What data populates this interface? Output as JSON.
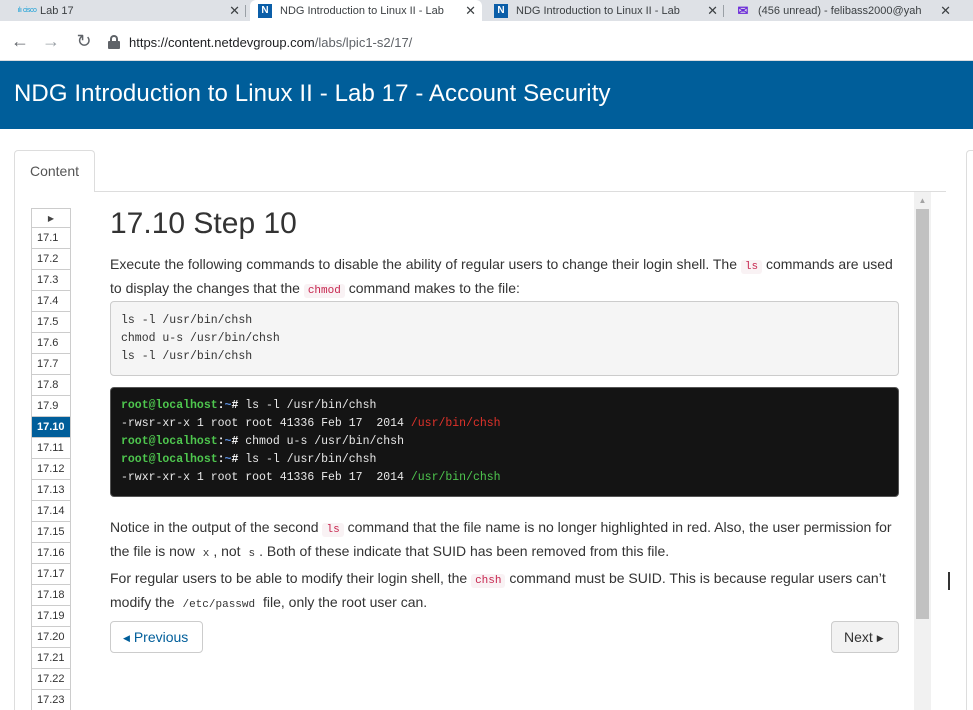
{
  "browser": {
    "tabs": [
      {
        "title": "Lab 17",
        "icon": "cisco-icon",
        "active": false
      },
      {
        "title": "NDG Introduction to Linux II - Lab",
        "icon": "ndg-n-icon",
        "active": true
      },
      {
        "title": "NDG Introduction to Linux II - Lab",
        "icon": "ndg-n-icon",
        "active": false
      },
      {
        "title": "(456 unread) - felibass2000@yah",
        "icon": "yahoo-mail-icon",
        "active": false
      }
    ],
    "url_host": "https://content.netdevgroup.com",
    "url_path": "/labs/lpic1-s2/17/",
    "fav_n": "N",
    "fav_cisco": "ılıılı cisco"
  },
  "header": {
    "title": "NDG Introduction to Linux II - Lab 17 - Account Security"
  },
  "content_tab": {
    "label": "Content"
  },
  "step_nav": {
    "items": [
      "17.1",
      "17.2",
      "17.3",
      "17.4",
      "17.5",
      "17.6",
      "17.7",
      "17.8",
      "17.9",
      "17.10",
      "17.11",
      "17.12",
      "17.13",
      "17.14",
      "17.15",
      "17.16",
      "17.17",
      "17.18",
      "17.19",
      "17.20",
      "17.21",
      "17.22",
      "17.23"
    ],
    "active": "17.10"
  },
  "main": {
    "heading": "17.10 Step 10",
    "intro": {
      "t1": "Execute the following commands to disable the ability of regular users to change their login shell. The ",
      "c1": "ls",
      "t2": " commands are used to display the changes that the ",
      "c2": "chmod",
      "t3": " command makes to the file:"
    },
    "commands": [
      "ls -l /usr/bin/chsh",
      "chmod u-s /usr/bin/chsh",
      "ls -l /usr/bin/chsh"
    ],
    "terminal": {
      "prompt_user": "root@localhost",
      "prompt_colon": ":",
      "prompt_tilde": "~",
      "prompt_hash": "#",
      "cmd1": " ls -l /usr/bin/chsh",
      "out1_prefix": "-rwsr-xr-x 1 root root 41336 Feb 17  2014 ",
      "out1_file": "/usr/bin/chsh",
      "cmd2": " chmod u-s /usr/bin/chsh",
      "cmd3": " ls -l /usr/bin/chsh",
      "out2_prefix": "-rwxr-xr-x 1 root root 41336 Feb 17  2014 ",
      "out2_file": "/usr/bin/chsh"
    },
    "notice": {
      "t1": "Notice in the output of the second ",
      "c1": "ls",
      "t2": " command that the file name is no longer highlighted in red. Also, the user permission for the file is now ",
      "c2": "x",
      "t3": ", not ",
      "c3": "s",
      "t4": ". Both of these indicate that SUID has been removed from this file."
    },
    "regular": {
      "t1": "For regular users to be able to modify their login shell, the ",
      "c1": "chsh",
      "t2": " command must be SUID. This is because regular users can’t modify the ",
      "c2": "/etc/passwd",
      "t3": " file, only the root user can."
    },
    "prev_label": "Previous",
    "next_label": "Next"
  }
}
